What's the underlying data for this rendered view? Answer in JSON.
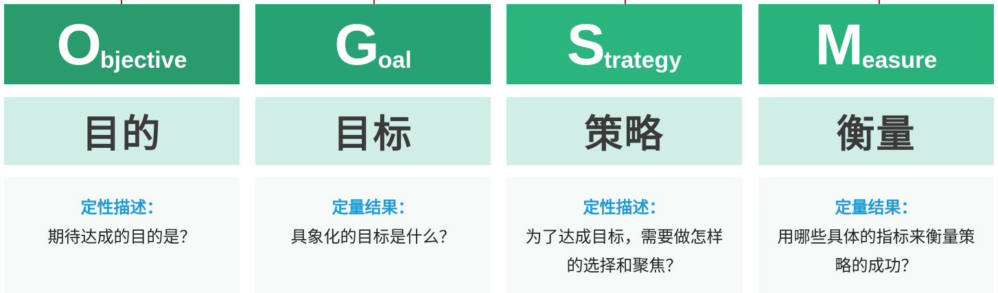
{
  "columns": [
    {
      "initial": "O",
      "rest": "bjective",
      "chinese": "目的",
      "label": "定性描述：",
      "question": "期待达成的目的是？",
      "header_color": "#2a9b6c"
    },
    {
      "initial": "G",
      "rest": "oal",
      "chinese": "目标",
      "label": "定量结果：",
      "question": "具象化的目标是什么？",
      "header_color": "#27a274"
    },
    {
      "initial": "S",
      "rest": "trategy",
      "chinese": "策略",
      "label": "定性描述：",
      "question": "为了达成目标，需要做怎样的选择和聚焦？",
      "header_color": "#2bb47e"
    },
    {
      "initial": "M",
      "rest": "easure",
      "chinese": "衡量",
      "label": "定量结果：",
      "question": "用哪些具体的指标来衡量策略的成功？",
      "header_color": "#2ab27d"
    }
  ],
  "colors": {
    "chinese_band": "#d0ede6",
    "desc_bg": "#f6faf9",
    "label_blue": "#1a9ad8",
    "accent_red": "#c0121a"
  }
}
